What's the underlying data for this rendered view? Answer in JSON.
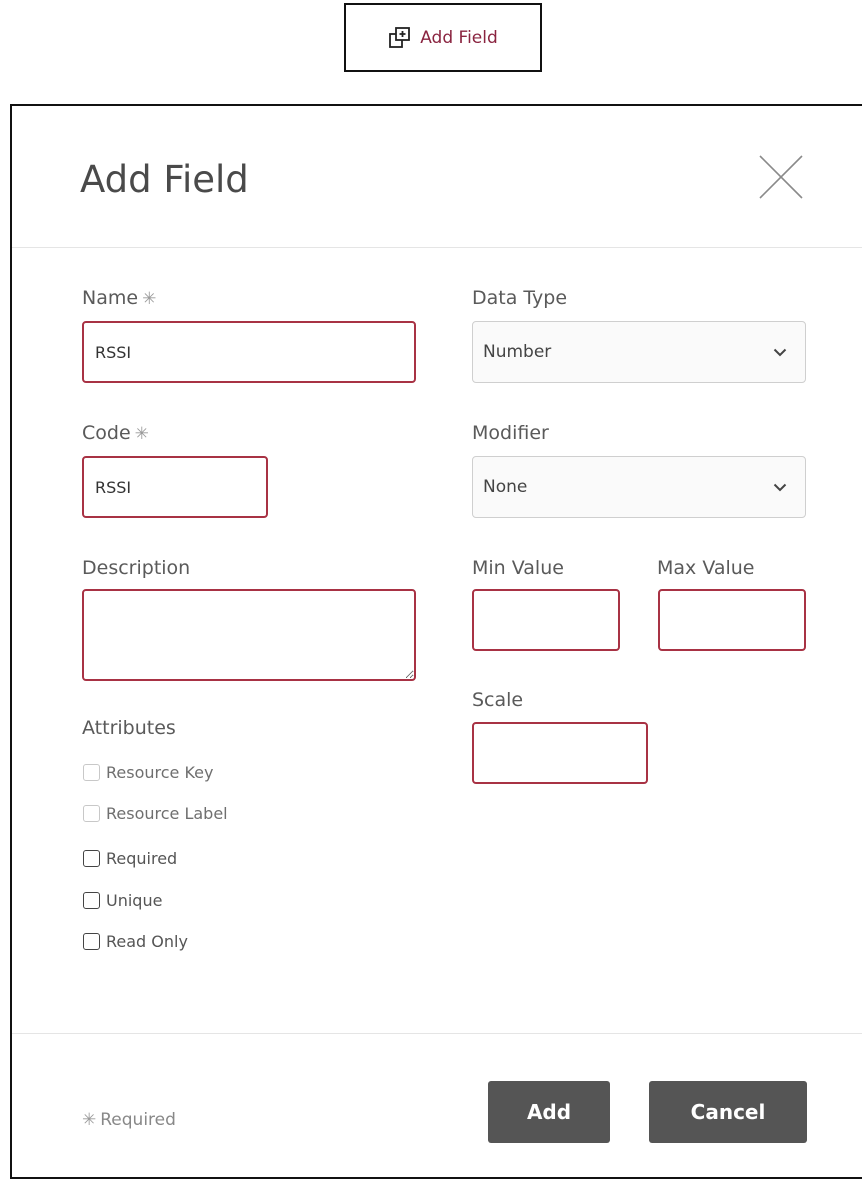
{
  "trigger": {
    "label": "Add Field",
    "icon": "add-field-icon"
  },
  "dialog": {
    "title": "Add Field",
    "close_icon": "close-icon"
  },
  "form": {
    "name": {
      "label": "Name",
      "required_mark": "✳",
      "value": "RSSI"
    },
    "code": {
      "label": "Code",
      "required_mark": "✳",
      "value": "RSSI"
    },
    "description": {
      "label": "Description",
      "value": ""
    },
    "data_type": {
      "label": "Data Type",
      "value": "Number",
      "icon": "chevron-down-icon"
    },
    "modifier": {
      "label": "Modifier",
      "value": "None",
      "icon": "chevron-down-icon"
    },
    "min_value": {
      "label": "Min Value",
      "value": ""
    },
    "max_value": {
      "label": "Max Value",
      "value": ""
    },
    "scale": {
      "label": "Scale",
      "value": ""
    },
    "attributes": {
      "heading": "Attributes",
      "items": [
        {
          "label": "Resource Key",
          "checked": false,
          "disabled": true
        },
        {
          "label": "Resource Label",
          "checked": false,
          "disabled": true
        },
        {
          "label": "Required",
          "checked": false,
          "disabled": false
        },
        {
          "label": "Unique",
          "checked": false,
          "disabled": false
        },
        {
          "label": "Read Only",
          "checked": false,
          "disabled": false
        }
      ]
    }
  },
  "footer": {
    "required_mark": "✳",
    "required_note": "Required",
    "add_label": "Add",
    "cancel_label": "Cancel"
  },
  "colors": {
    "accent": "#8a2440",
    "invalid_border": "#a83244",
    "button_bg": "#555555"
  }
}
